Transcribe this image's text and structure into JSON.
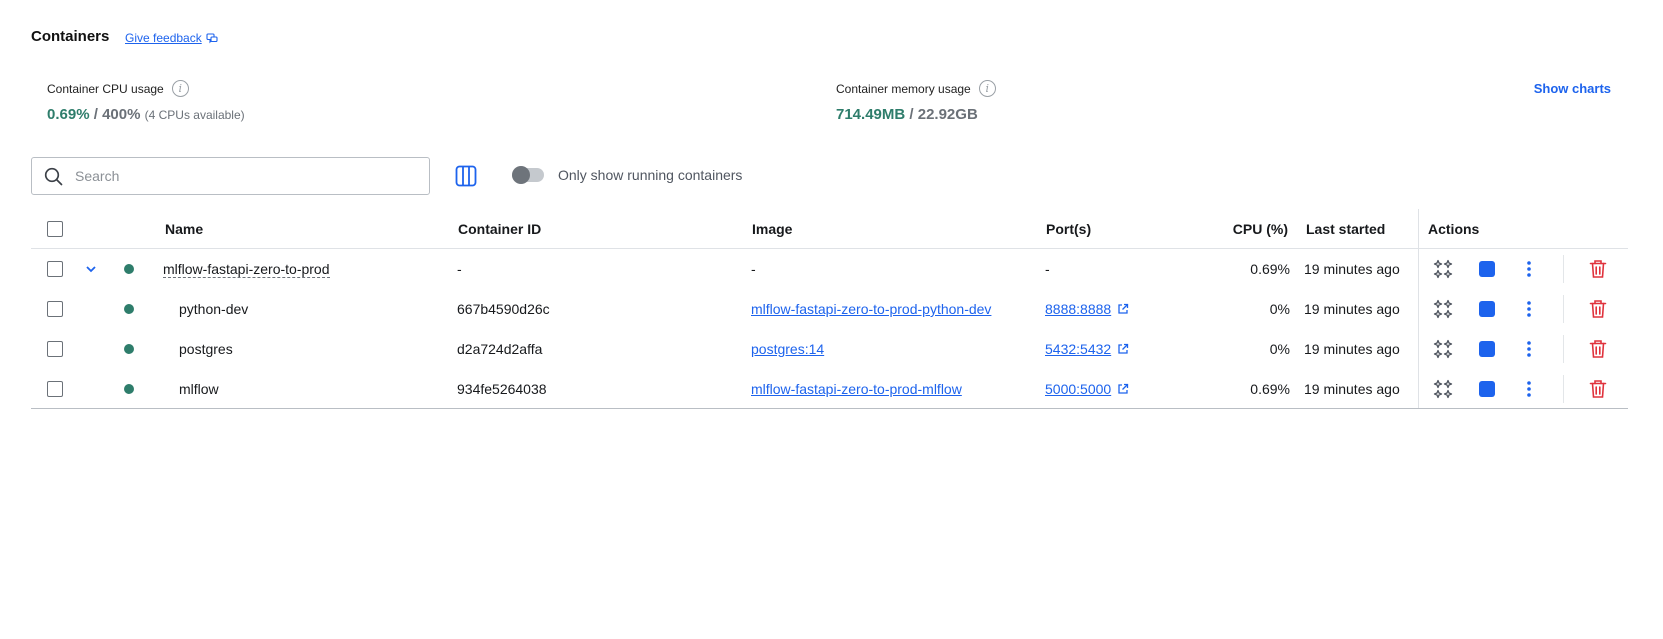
{
  "header": {
    "title": "Containers",
    "feedback_label": "Give feedback"
  },
  "stats": {
    "cpu_label": "Container CPU usage",
    "cpu_used": "0.69%",
    "cpu_total": "400%",
    "cpu_note": "(4 CPUs available)",
    "mem_label": "Container memory usage",
    "mem_used": "714.49MB",
    "mem_total": "22.92GB",
    "separator": "/",
    "show_charts": "Show charts"
  },
  "toolbar": {
    "search_placeholder": "Search",
    "toggle_label": "Only show running containers",
    "toggle_on": false
  },
  "table": {
    "columns": {
      "name": "Name",
      "container_id": "Container ID",
      "image": "Image",
      "ports": "Port(s)",
      "cpu": "CPU (%)",
      "last_started": "Last started",
      "actions": "Actions"
    },
    "rows": [
      {
        "name": "mlflow-fastapi-zero-to-prod",
        "container_id": "-",
        "image": "-",
        "ports": "-",
        "cpu": "0.69%",
        "last_started": "19 minutes ago"
      },
      {
        "name": "python-dev",
        "container_id": "667b4590d26c",
        "image": "mlflow-fastapi-zero-to-prod-python-dev",
        "ports": "8888:8888",
        "cpu": "0%",
        "last_started": "19 minutes ago"
      },
      {
        "name": "postgres",
        "container_id": "d2a724d2affa",
        "image": "postgres:14",
        "ports": "5432:5432",
        "cpu": "0%",
        "last_started": "19 minutes ago"
      },
      {
        "name": "mlflow",
        "container_id": "934fe5264038",
        "image": "mlflow-fastapi-zero-to-prod-mlflow",
        "ports": "5000:5000",
        "cpu": "0.69%",
        "last_started": "19 minutes ago"
      }
    ]
  },
  "colors": {
    "accent": "#1d63ed",
    "running": "#2e7d6b",
    "delete": "#e0323c"
  }
}
